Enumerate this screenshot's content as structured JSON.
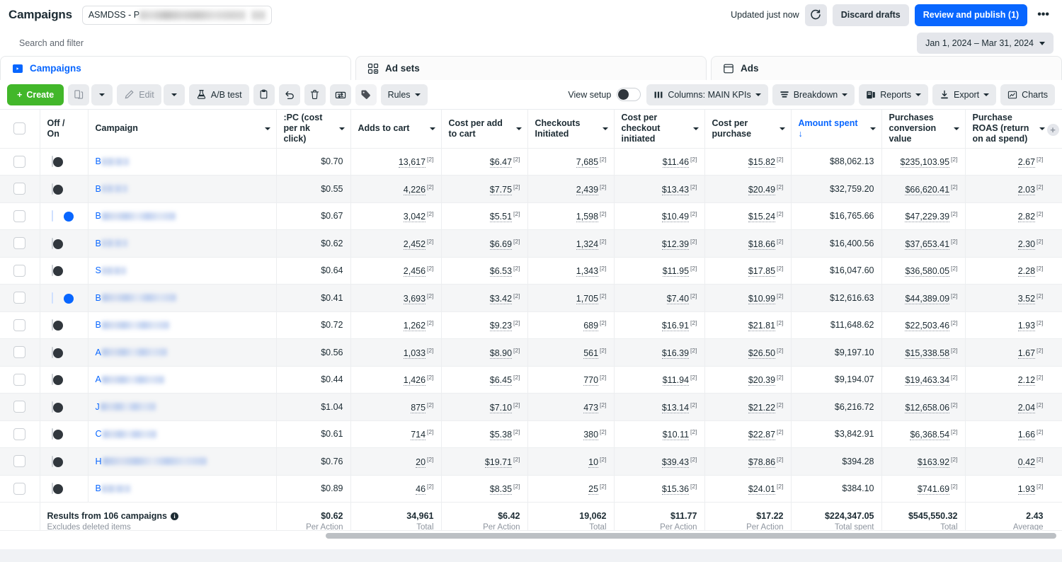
{
  "header": {
    "title": "Campaigns",
    "account_name": "ASMDSS - P",
    "updated_text": "Updated just now",
    "refresh_icon": "refresh-icon",
    "discard_label": "Discard drafts",
    "publish_label": "Review and publish (1)",
    "more_label": "•••"
  },
  "search": {
    "placeholder": "Search and filter",
    "date_range": "Jan 1, 2024 – Mar 31, 2024"
  },
  "tabs": [
    {
      "label": "Campaigns",
      "icon": "campaigns-icon",
      "active": true
    },
    {
      "label": "Ad sets",
      "icon": "adsets-icon",
      "active": false
    },
    {
      "label": "Ads",
      "icon": "ads-icon",
      "active": false
    }
  ],
  "toolbar": {
    "create_label": "Create",
    "duplicate_icon": "duplicate-icon",
    "duplicate_caret": "chevron-down-icon",
    "edit_label": "Edit",
    "edit_icon": "pencil-icon",
    "edit_caret": "chevron-down-icon",
    "abtest_label": "A/B test",
    "abtest_icon": "flask-icon",
    "clipboard_icon": "clipboard-icon",
    "undo_icon": "undo-icon",
    "trash_icon": "trash-icon",
    "export_arrows_icon": "exchange-icon",
    "tag_icon": "tag-icon",
    "rules_label": "Rules",
    "view_setup_label": "View setup",
    "columns_label": "Columns: MAIN KPIs",
    "columns_icon": "columns-icon",
    "breakdown_label": "Breakdown",
    "breakdown_icon": "breakdown-icon",
    "reports_label": "Reports",
    "reports_icon": "reports-icon",
    "export_label": "Export",
    "export_icon": "download-icon",
    "charts_label": "Charts",
    "charts_icon": "chart-icon"
  },
  "table": {
    "columns": [
      {
        "key": "check",
        "label": ""
      },
      {
        "key": "offon",
        "label": "Off / On"
      },
      {
        "key": "campaign",
        "label": "Campaign"
      },
      {
        "key": "cpc",
        "label": "CPC (cost per link click)",
        "truncated_label": ":PC (cost per nk click)"
      },
      {
        "key": "atc",
        "label": "Adds to cart"
      },
      {
        "key": "cpatc",
        "label": "Cost per add to cart"
      },
      {
        "key": "checkouts",
        "label": "Checkouts Initiated"
      },
      {
        "key": "cpci",
        "label": "Cost per checkout initiated"
      },
      {
        "key": "cpp",
        "label": "Cost per purchase"
      },
      {
        "key": "spent",
        "label": "Amount spent ↓",
        "sorted": true
      },
      {
        "key": "pcv",
        "label": "Purchases conversion value"
      },
      {
        "key": "roas",
        "label": "Purchase ROAS (return on ad spend)"
      }
    ],
    "rows": [
      {
        "initial": "B",
        "blur_w": 38,
        "on": false,
        "cpc": "$0.70",
        "atc": "13,617",
        "cpatc": "$6.47",
        "checkouts": "7,685",
        "cpci": "$11.46",
        "cpp": "$15.82",
        "spent": "$88,062.13",
        "pcv": "$235,103.95",
        "roas": "2.67"
      },
      {
        "initial": "B",
        "blur_w": 36,
        "on": false,
        "cpc": "$0.55",
        "atc": "4,226",
        "cpatc": "$7.75",
        "checkouts": "2,439",
        "cpci": "$13.43",
        "cpp": "$20.49",
        "spent": "$32,759.20",
        "pcv": "$66,620.41",
        "roas": "2.03"
      },
      {
        "initial": "B",
        "blur_w": 104,
        "on": true,
        "cpc": "$0.67",
        "atc": "3,042",
        "cpatc": "$5.51",
        "checkouts": "1,598",
        "cpci": "$10.49",
        "cpp": "$15.24",
        "spent": "$16,765.66",
        "pcv": "$47,229.39",
        "roas": "2.82"
      },
      {
        "initial": "B",
        "blur_w": 36,
        "on": false,
        "cpc": "$0.62",
        "atc": "2,452",
        "cpatc": "$6.69",
        "checkouts": "1,324",
        "cpci": "$12.39",
        "cpp": "$18.66",
        "spent": "$16,400.56",
        "pcv": "$37,653.41",
        "roas": "2.30"
      },
      {
        "initial": "S",
        "blur_w": 34,
        "on": false,
        "cpc": "$0.64",
        "atc": "2,456",
        "cpatc": "$6.53",
        "checkouts": "1,343",
        "cpci": "$11.95",
        "cpp": "$17.85",
        "spent": "$16,047.60",
        "pcv": "$36,580.05",
        "roas": "2.28"
      },
      {
        "initial": "B",
        "blur_w": 105,
        "on": true,
        "cpc": "$0.41",
        "atc": "3,693",
        "cpatc": "$3.42",
        "checkouts": "1,705",
        "cpci": "$7.40",
        "cpp": "$10.99",
        "spent": "$12,616.63",
        "pcv": "$44,389.09",
        "roas": "3.52"
      },
      {
        "initial": "B",
        "blur_w": 95,
        "on": false,
        "cpc": "$0.72",
        "atc": "1,262",
        "cpatc": "$9.23",
        "checkouts": "689",
        "cpci": "$16.91",
        "cpp": "$21.81",
        "spent": "$11,648.62",
        "pcv": "$22,503.46",
        "roas": "1.93"
      },
      {
        "initial": "A",
        "blur_w": 92,
        "on": false,
        "cpc": "$0.56",
        "atc": "1,033",
        "cpatc": "$8.90",
        "checkouts": "561",
        "cpci": "$16.39",
        "cpp": "$26.50",
        "spent": "$9,197.10",
        "pcv": "$15,338.58",
        "roas": "1.67"
      },
      {
        "initial": "A",
        "blur_w": 88,
        "on": false,
        "cpc": "$0.44",
        "atc": "1,426",
        "cpatc": "$6.45",
        "checkouts": "770",
        "cpci": "$11.94",
        "cpp": "$20.39",
        "spent": "$9,194.07",
        "pcv": "$19,463.34",
        "roas": "2.12"
      },
      {
        "initial": "J",
        "blur_w": 78,
        "on": false,
        "cpc": "$1.04",
        "atc": "875",
        "cpatc": "$7.10",
        "checkouts": "473",
        "cpci": "$13.14",
        "cpp": "$21.22",
        "spent": "$6,216.72",
        "pcv": "$12,658.06",
        "roas": "2.04"
      },
      {
        "initial": "C",
        "blur_w": 76,
        "on": false,
        "cpc": "$0.61",
        "atc": "714",
        "cpatc": "$5.38",
        "checkouts": "380",
        "cpci": "$10.11",
        "cpp": "$22.87",
        "spent": "$3,842.91",
        "pcv": "$6,368.54",
        "roas": "1.66"
      },
      {
        "initial": "H",
        "blur_w": 147,
        "on": false,
        "cpc": "$0.76",
        "atc": "20",
        "cpatc": "$19.71",
        "checkouts": "10",
        "cpci": "$39.43",
        "cpp": "$78.86",
        "spent": "$394.28",
        "pcv": "$163.92",
        "roas": "0.42"
      },
      {
        "initial": "B",
        "blur_w": 40,
        "on": false,
        "cpc": "$0.89",
        "atc": "46",
        "cpatc": "$8.35",
        "checkouts": "25",
        "cpci": "$15.36",
        "cpp": "$24.01",
        "spent": "$384.10",
        "pcv": "$741.69",
        "roas": "1.93"
      }
    ],
    "superscript": "[2]",
    "summary": {
      "title": "Results from 106 campaigns",
      "subtitle": "Excludes deleted items",
      "cpc": {
        "value": "$0.62",
        "label": "Per Action"
      },
      "atc": {
        "value": "34,961",
        "label": "Total"
      },
      "cpatc": {
        "value": "$6.42",
        "label": "Per Action"
      },
      "checkouts": {
        "value": "19,062",
        "label": "Total"
      },
      "cpci": {
        "value": "$11.77",
        "label": "Per Action"
      },
      "cpp": {
        "value": "$17.22",
        "label": "Per Action"
      },
      "spent": {
        "value": "$224,347.05",
        "label": "Total spent"
      },
      "pcv": {
        "value": "$545,550.32",
        "label": "Total"
      },
      "roas": {
        "value": "2.43",
        "label": "Average"
      }
    }
  },
  "colors": {
    "brand_blue": "#0866ff",
    "create_green": "#42b72a",
    "text": "#1c2b33",
    "muted": "#8d949e"
  }
}
